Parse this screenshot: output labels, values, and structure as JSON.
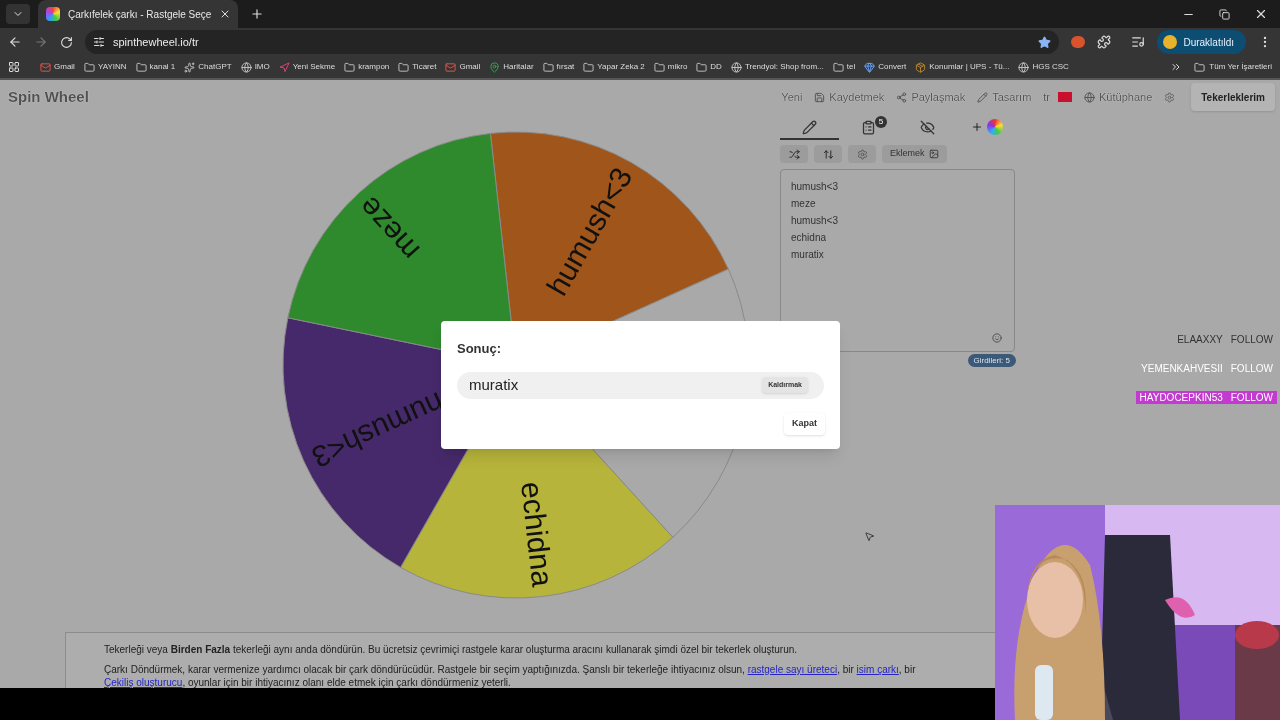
{
  "browser": {
    "tab": {
      "title": "Çarkıfelek çarkı - Rastgele Seçe",
      "selected": true
    },
    "url": "spinthewheel.io/tr",
    "profile": "Duraklatıldı",
    "bookmarks": [
      {
        "label": "Gmail",
        "kind": "mail"
      },
      {
        "label": "YAYINN",
        "kind": "folder"
      },
      {
        "label": "kanal 1",
        "kind": "folder"
      },
      {
        "label": "ChatGPT",
        "kind": "ai"
      },
      {
        "label": "IMO",
        "kind": "globe"
      },
      {
        "label": "Yeni Sekme",
        "kind": "arrow"
      },
      {
        "label": "krampon",
        "kind": "folder"
      },
      {
        "label": "Ticaret",
        "kind": "folder"
      },
      {
        "label": "Gmail",
        "kind": "mail"
      },
      {
        "label": "Haritalar",
        "kind": "map"
      },
      {
        "label": "fırsat",
        "kind": "folder"
      },
      {
        "label": "Yapar Zeka 2",
        "kind": "folder"
      },
      {
        "label": "mikro",
        "kind": "folder"
      },
      {
        "label": "DD",
        "kind": "folder"
      },
      {
        "label": "Trendyol: Shop from...",
        "kind": "globe"
      },
      {
        "label": "tel",
        "kind": "folder"
      },
      {
        "label": "Convert",
        "kind": "gem"
      },
      {
        "label": "Konumlar | UPS - Tü...",
        "kind": "package"
      },
      {
        "label": "HGS CSC",
        "kind": "globe"
      }
    ],
    "all_bookmarks": "Tüm Yer İşaretleri"
  },
  "site": {
    "logo": "Spin Wheel",
    "nav": [
      {
        "label": "Yeni",
        "kind": "text"
      },
      {
        "label": "Kaydetmek",
        "kind": "save"
      },
      {
        "label": "Paylaşmak",
        "kind": "share"
      },
      {
        "label": "Tasarım",
        "kind": "design"
      },
      {
        "label": "tr",
        "kind": "lang"
      },
      {
        "label": "Kütüphane",
        "kind": "library"
      }
    ],
    "my_wheels": "Tekerleklerim",
    "wheel": [
      {
        "label": "humush<3",
        "color": "#a0561a"
      },
      {
        "color": "#a9a9a9"
      },
      {
        "label": "echidna",
        "color": "#b6b43a"
      },
      {
        "label": "humush<3",
        "color": "#46296a"
      },
      {
        "label": "meze",
        "color": "#2e8a2c"
      }
    ],
    "panel_tabs": [
      {
        "kind": "edit",
        "selected": true
      },
      {
        "kind": "results",
        "badge": "5",
        "selected": false
      },
      {
        "kind": "hide",
        "selected": false
      },
      {
        "kind": "customize",
        "selected": false
      }
    ],
    "add_button": "Eklemek",
    "entries": [
      "humush<3",
      "meze",
      "humush<3",
      "echidna",
      "muratix"
    ],
    "entries_count": "Girdileri: 5",
    "description": [
      "Tekerleği veya **Birden Fazla** tekerleği aynı anda döndürün. Bu ücretsiz çevrimiçi rastgele karar oluşturma aracını kullanarak şimdi özel bir tekerlek oluşturun.",
      [
        {
          "text": "Çarkı Döndürmek, karar vermenize yardımcı olacak bir çark döndürücüdür. Rastgele bir seçim yaptığınızda. Şanslı bir tekerleğe ihtiyacınız olsun, "
        },
        {
          "link": "rastgele sayı üreteci"
        },
        {
          "text": ", bir "
        },
        {
          "link": "isim çarkı"
        },
        {
          "text": ", bir "
        },
        {
          "link": "Çekiliş oluşturucu"
        },
        {
          "text": ", oyunlar için bir ihtiyacınız olanı elde etmek için çarkı döndürmeniz yeterli."
        }
      ]
    ]
  },
  "dialog": {
    "title": "Sonuç:",
    "result": "muratix",
    "remove": "Kaldırmak",
    "close": "Kapat"
  },
  "follows": [
    {
      "name": "ELAAXXY",
      "action": "FOLLOW",
      "highlighted": false
    },
    {
      "name": "YEMENKAHVESII",
      "action": "FOLLOW",
      "highlighted": false
    },
    {
      "name": "HAYDOCEPKIN53",
      "action": "FOLLOW",
      "highlighted": true
    }
  ]
}
